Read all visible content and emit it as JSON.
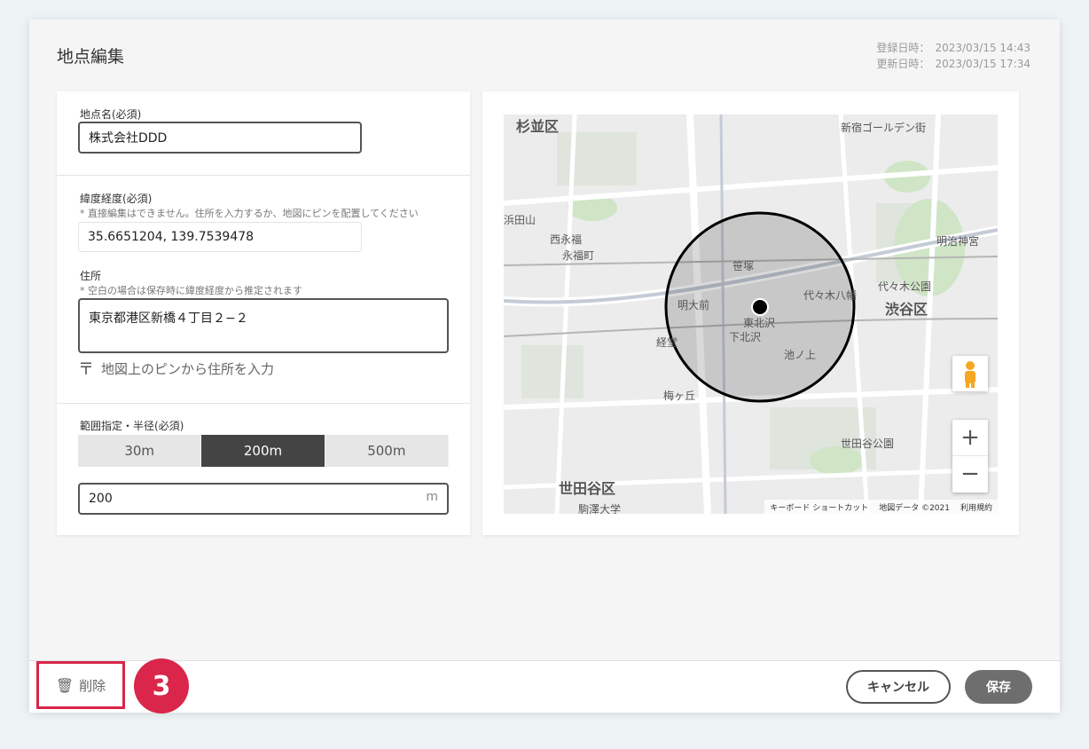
{
  "page": {
    "title": "地点編集",
    "created_label": "登録日時：",
    "created_value": "2023/03/15 14:43",
    "updated_label": "更新日時：",
    "updated_value": "2023/03/15 17:34"
  },
  "form": {
    "name_label": "地点名(必須)",
    "name_value": "株式会社DDD",
    "latlng_label": "緯度経度(必須)",
    "latlng_note": "* 直接編集はできません。住所を入力するか、地図にピンを配置してください",
    "latlng_value": "35.6651204, 139.7539478",
    "address_label": "住所",
    "address_note": "* 空白の場合は保存時に緯度経度から推定されます",
    "address_value": "東京都港区新橋４丁目２−２",
    "pin_link": "地図上のピンから住所を入力",
    "pin_icon": "pin-to-address-icon",
    "range_label": "範囲指定・半径(必須)",
    "range_options": [
      "30m",
      "200m",
      "500m"
    ],
    "range_selected": "200m",
    "radius_value": "200",
    "radius_unit": "m"
  },
  "map": {
    "labels": {
      "suginami": "杉並区",
      "shibuya": "渋谷区",
      "setagaya": "世田谷区",
      "shinjuku_golden": "新宿ゴールデン街",
      "higashi_kitazawa": "東北沢",
      "shimokitazawa": "下北沢",
      "sasazuka": "笹塚",
      "yoyogi_hachiman": "代々木八幡",
      "yoyogi_park": "代々木公園",
      "meiji_jingu": "明治神宮",
      "hamadayama": "浜田山",
      "nishi_eifuku": "西永福",
      "eifukucho": "永福町",
      "meidaimae": "明大前",
      "kyodo": "経堂",
      "umegaoka": "梅ヶ丘",
      "ikenoue": "池ノ上",
      "setagaya_park": "世田谷公園",
      "komazawa": "駒澤大学"
    },
    "zoom_in": "+",
    "zoom_out": "−",
    "attribution": [
      "キーボード ショートカット",
      "地図データ ©2021",
      "利用規約"
    ]
  },
  "footer": {
    "delete_label": "削除",
    "delete_icon": "trash-icon",
    "step_number": "3",
    "cancel_label": "キャンセル",
    "save_label": "保存"
  },
  "colors": {
    "accent": "#d9264a",
    "selected_segment": "#444444",
    "save_button": "#6e6e6e"
  }
}
